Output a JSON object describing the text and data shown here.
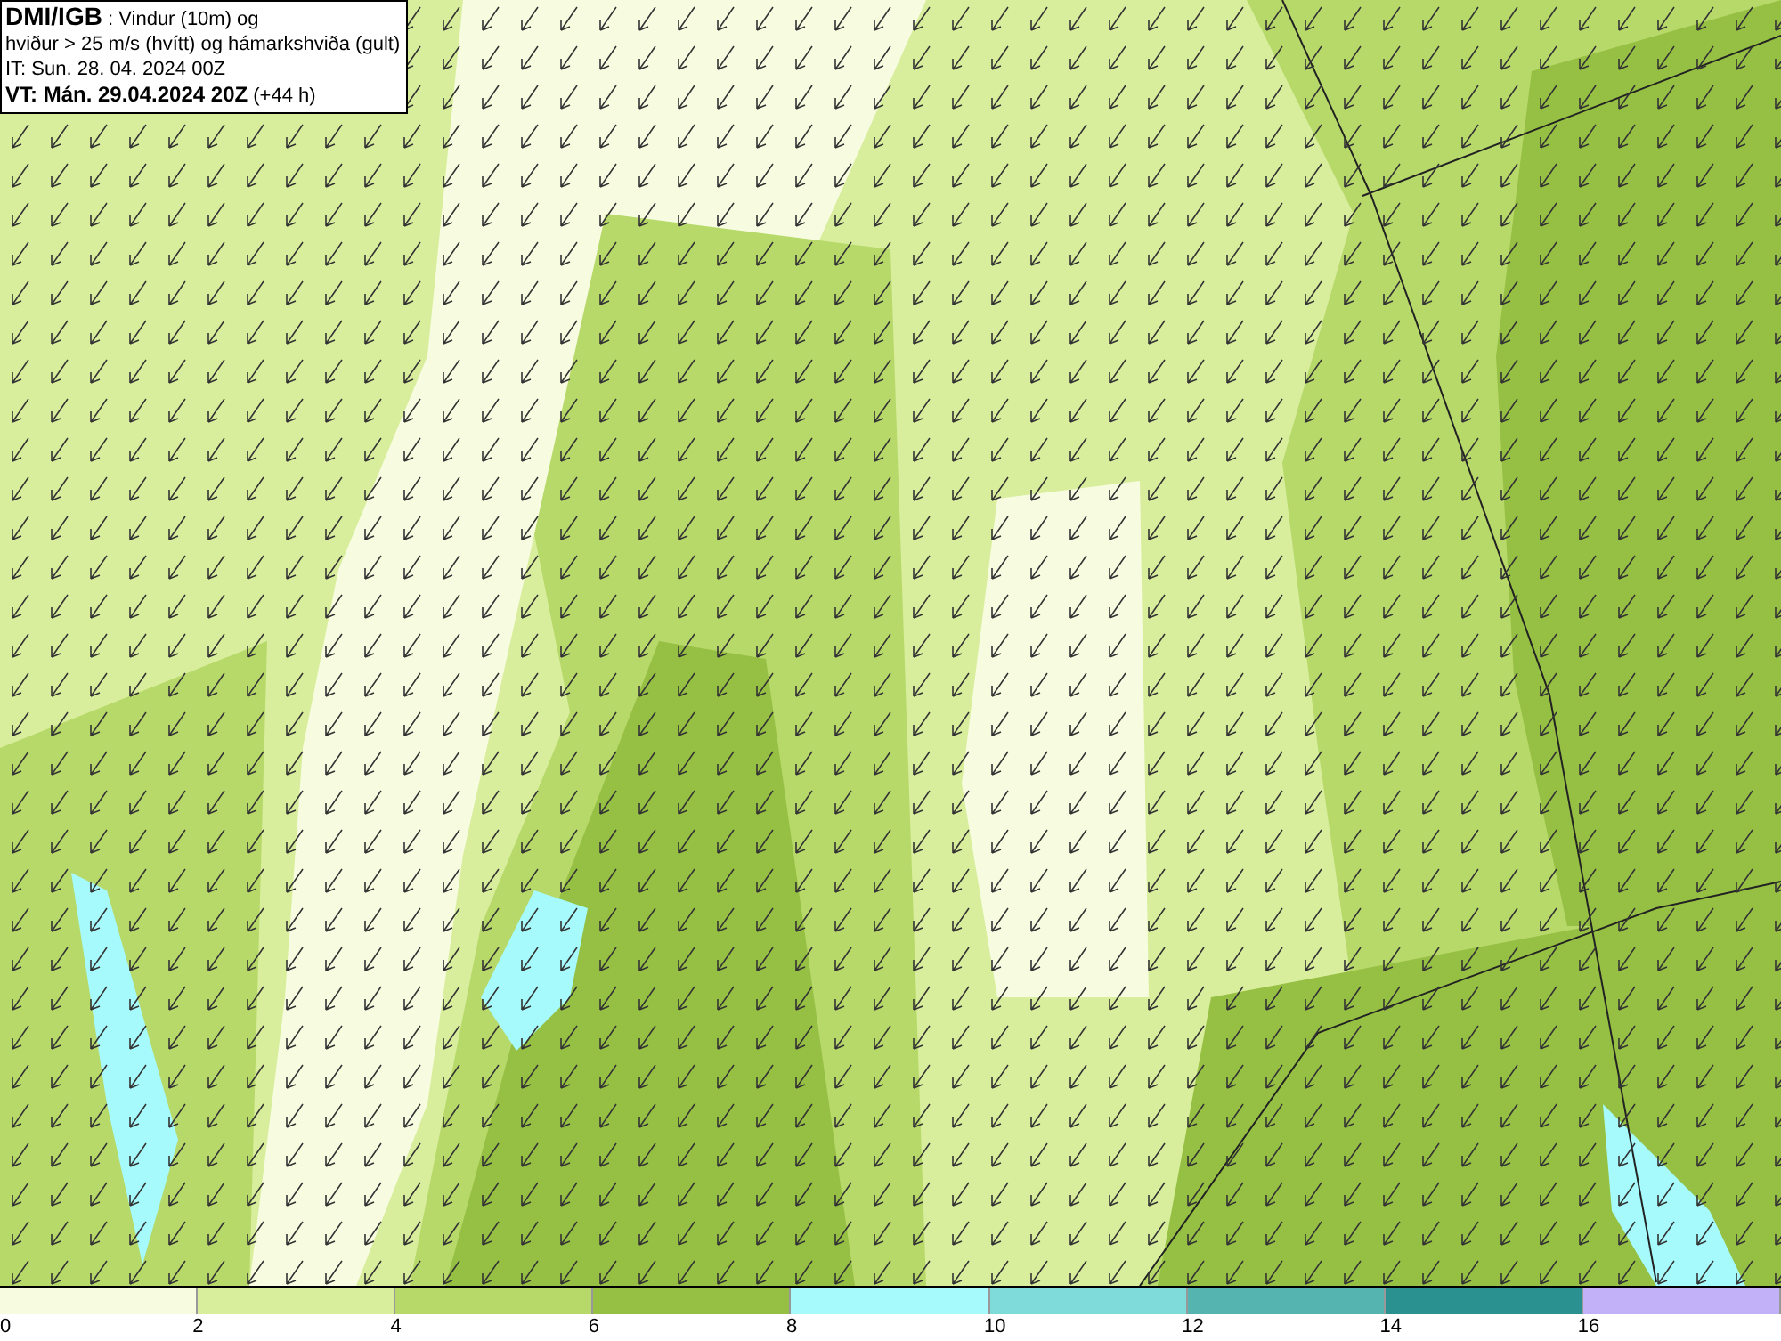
{
  "header": {
    "lines": [
      "**DMI/IGB** : Vindur (10m) og",
      "hviður > 25 m/s (hvítt) og hámarkshviða (gult)",
      "IT: Sun. 28. 04. 2024 00Z",
      "**VT: Mán. 29.04.2024 20Z** (+44 h)"
    ]
  },
  "legend": {
    "bins": [
      {
        "label": "0",
        "color": "#f7fce0"
      },
      {
        "label": "2",
        "color": "#d8ee9c"
      },
      {
        "label": "4",
        "color": "#b7d96a"
      },
      {
        "label": "6",
        "color": "#96c043"
      },
      {
        "label": "8",
        "color": "#a6fafc"
      },
      {
        "label": "10",
        "color": "#7fdbd9"
      },
      {
        "label": "12",
        "color": "#55b3b0"
      },
      {
        "label": "14",
        "color": "#2a9190"
      },
      {
        "label": "16",
        "color": "#c2b0f8"
      }
    ]
  }
}
